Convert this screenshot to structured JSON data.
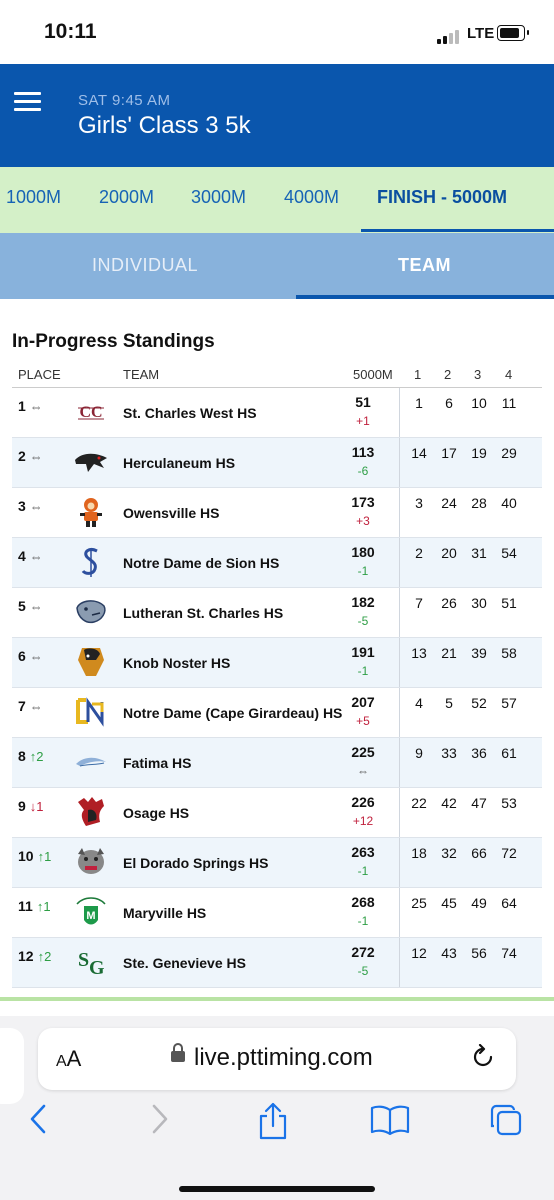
{
  "status_bar": {
    "time": "10:11",
    "network": "LTE"
  },
  "header": {
    "meet_time": "SAT 9:45 AM",
    "race_title": "Girls' Class 3 5k"
  },
  "split_tabs": [
    {
      "label": "1000M",
      "active": false
    },
    {
      "label": "2000M",
      "active": false
    },
    {
      "label": "3000M",
      "active": false
    },
    {
      "label": "4000M",
      "active": false
    },
    {
      "label": "FINISH - 5000M",
      "active": true
    }
  ],
  "view_tabs": [
    {
      "label": "INDIVIDUAL",
      "active": false
    },
    {
      "label": "TEAM",
      "active": true
    }
  ],
  "standings": {
    "title": "In-Progress Standings",
    "headers": {
      "place": "PLACE",
      "team": "TEAM",
      "score": "5000M",
      "p1": "1",
      "p2": "2",
      "p3": "3",
      "p4": "4"
    },
    "rows": [
      {
        "place": "1",
        "change": "⇔",
        "team": "St. Charles West HS",
        "score": "51",
        "delta": "+1",
        "places": [
          "1",
          "6",
          "10",
          "11"
        ]
      },
      {
        "place": "2",
        "change": "⇔",
        "team": "Herculaneum HS",
        "score": "113",
        "delta": "-6",
        "places": [
          "14",
          "17",
          "19",
          "29"
        ]
      },
      {
        "place": "3",
        "change": "⇔",
        "team": "Owensville HS",
        "score": "173",
        "delta": "+3",
        "places": [
          "3",
          "24",
          "28",
          "40"
        ]
      },
      {
        "place": "4",
        "change": "⇔",
        "team": "Notre Dame de Sion HS",
        "score": "180",
        "delta": "-1",
        "places": [
          "2",
          "20",
          "31",
          "54"
        ]
      },
      {
        "place": "5",
        "change": "⇔",
        "team": "Lutheran St. Charles HS",
        "score": "182",
        "delta": "-5",
        "places": [
          "7",
          "26",
          "30",
          "51"
        ]
      },
      {
        "place": "6",
        "change": "⇔",
        "team": "Knob Noster HS",
        "score": "191",
        "delta": "-1",
        "places": [
          "13",
          "21",
          "39",
          "58"
        ]
      },
      {
        "place": "7",
        "change": "⇔",
        "team": "Notre Dame (Cape Girardeau) HS",
        "score": "207",
        "delta": "+5",
        "places": [
          "4",
          "5",
          "52",
          "57"
        ]
      },
      {
        "place": "8",
        "change": "↑2",
        "team": "Fatima HS",
        "score": "225",
        "delta": "⇔",
        "places": [
          "9",
          "33",
          "36",
          "61"
        ]
      },
      {
        "place": "9",
        "change": "↓1",
        "team": "Osage HS",
        "score": "226",
        "delta": "+12",
        "places": [
          "22",
          "42",
          "47",
          "53"
        ]
      },
      {
        "place": "10",
        "change": "↑1",
        "team": "El Dorado Springs HS",
        "score": "263",
        "delta": "-1",
        "places": [
          "18",
          "32",
          "66",
          "72"
        ]
      },
      {
        "place": "11",
        "change": "↑1",
        "team": "Maryville HS",
        "score": "268",
        "delta": "-1",
        "places": [
          "25",
          "45",
          "49",
          "64"
        ]
      },
      {
        "place": "12",
        "change": "↑2",
        "team": "Ste. Genevieve HS",
        "score": "272",
        "delta": "-5",
        "places": [
          "12",
          "43",
          "56",
          "74"
        ]
      }
    ]
  },
  "browser": {
    "aa_label": "AA",
    "url": "live.pttiming.com"
  },
  "colors": {
    "header_blue": "#0a56ad",
    "split_bar": "#d4f0c8",
    "view_tabs": "#88b2dc",
    "gain": "#2e9e45",
    "loss": "#c0213d"
  }
}
